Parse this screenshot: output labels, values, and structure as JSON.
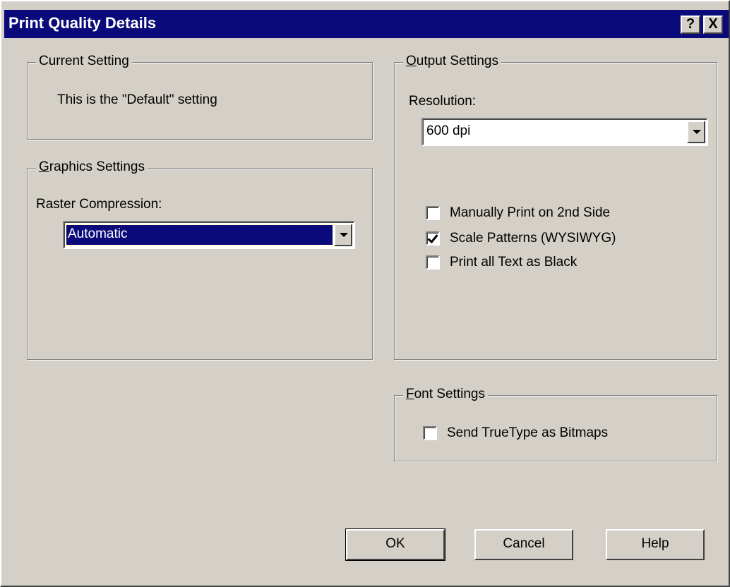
{
  "window": {
    "title": "Print Quality Details",
    "help_glyph": "?",
    "close_glyph": "X"
  },
  "current_setting": {
    "legend": "Current Setting",
    "text": "This is the \"Default\" setting"
  },
  "graphics_settings": {
    "legend_mnemonic": "G",
    "legend_rest": "raphics Settings",
    "raster_label": "Raster Compression:",
    "raster_value": "Automatic"
  },
  "output_settings": {
    "legend_mnemonic": "O",
    "legend_rest": "utput Settings",
    "resolution_label": "Resolution:",
    "resolution_value": "600 dpi",
    "options": [
      {
        "label": "Manually Print on 2nd Side",
        "checked": false
      },
      {
        "label": "Scale Patterns (WYSIWYG)",
        "checked": true
      },
      {
        "label": "Print all Text as Black",
        "checked": false
      }
    ]
  },
  "font_settings": {
    "legend_mnemonic": "F",
    "legend_rest": "ont Settings",
    "send_truetype_label": "Send TrueType as Bitmaps",
    "send_truetype_checked": false
  },
  "buttons": {
    "ok": "OK",
    "cancel": "Cancel",
    "help": "Help"
  }
}
